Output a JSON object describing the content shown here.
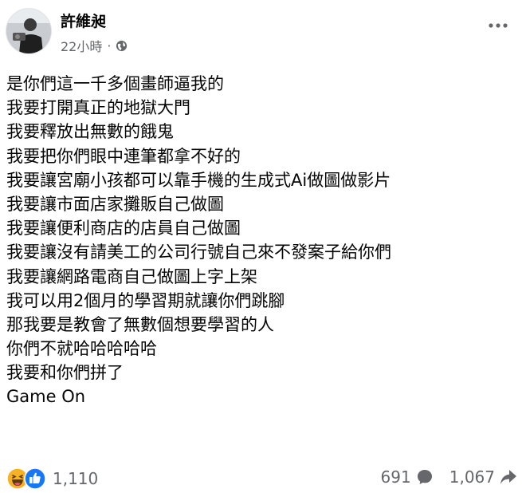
{
  "post": {
    "author": "許維昶",
    "time": "22小時",
    "separator": "·",
    "privacy_icon": "globe-icon",
    "more_icon": "more-horizontal-icon",
    "lines": [
      "是你們這一千多個畫師逼我的",
      "我要打開真正的地獄大門",
      "我要釋放出無數的餓鬼",
      "我要把你們眼中連筆都拿不好的",
      "我要讓宮廟小孩都可以靠手機的生成式Ai做圖做影片",
      "我要讓市面店家攤販自己做圖",
      "我要讓便利商店的店員自己做圖",
      "我要讓沒有請美工的公司行號自己來不發案子給你們",
      "我要讓網路電商自己做圖上字上架",
      "我可以用2個月的學習期就讓你們跳腳",
      "那我要是教會了無數個想要學習的人",
      "你們不就哈哈哈哈哈",
      "我要和你們拼了",
      "Game On"
    ]
  },
  "footer": {
    "reaction_icons": [
      "haha-icon",
      "like-icon"
    ],
    "reaction_count": "1,110",
    "comment_count": "691",
    "comment_icon": "comment-icon",
    "share_count": "1,067",
    "share_icon": "share-icon"
  },
  "colors": {
    "text": "#050505",
    "secondary": "#65676b",
    "like_blue": "#1877f2",
    "haha_yellow": "#f7b125"
  }
}
